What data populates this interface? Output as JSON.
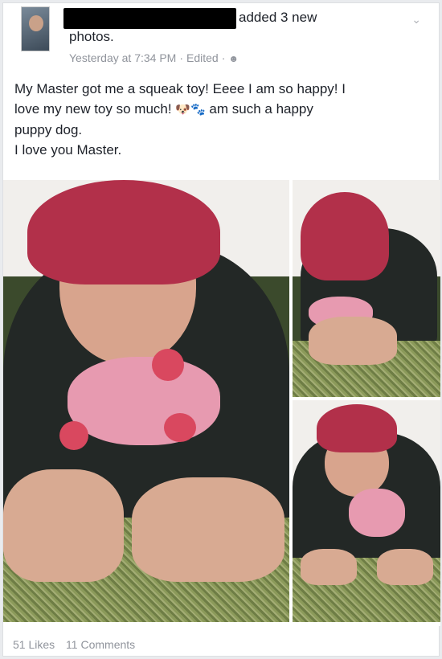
{
  "header": {
    "action_text": "added 3 new",
    "action_text_line2": "photos.",
    "timestamp": "Yesterday at 7:34 PM",
    "edited_label": "Edited",
    "separator": "·",
    "audience_icon": "friends-icon",
    "menu_icon": "chevron-down-icon"
  },
  "post": {
    "line1": "My Master got me a squeak toy! Eeee I am so happy! I",
    "line2_start": "love my new toy so much!",
    "line2_end": "am such a happy",
    "line3": "puppy dog.",
    "line4": "I love you Master.",
    "emoji_dog": "🐶",
    "emoji_paws": "🐾"
  },
  "photos": [
    {
      "name": "photo-main"
    },
    {
      "name": "photo-top-right"
    },
    {
      "name": "photo-bottom-right"
    }
  ],
  "footer": {
    "likes": "51 Likes",
    "comments": "11 Comments"
  },
  "colors": {
    "text": "#1d2129",
    "meta": "#90949c",
    "hair": "#b2304a",
    "toy": "#e79ab0"
  }
}
